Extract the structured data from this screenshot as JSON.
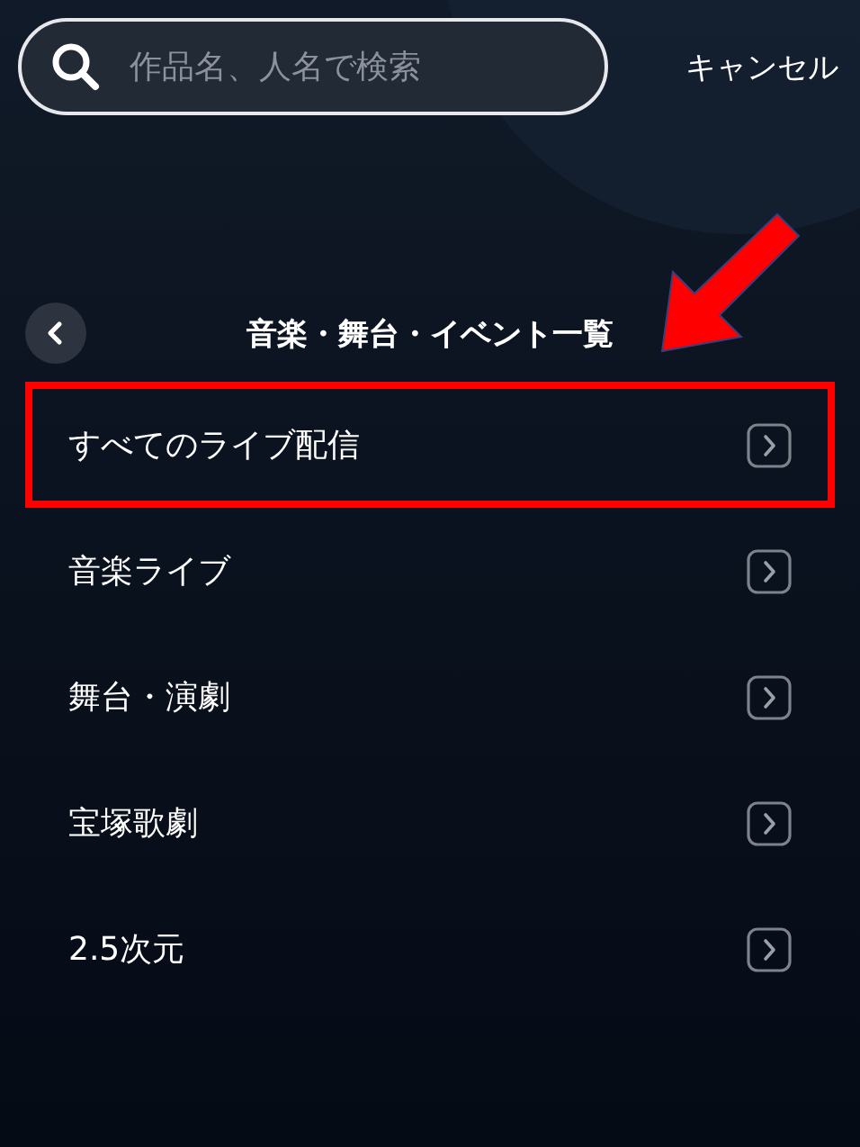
{
  "search": {
    "placeholder": "作品名、人名で検索"
  },
  "cancel_button": "キャンセル",
  "header": {
    "title": "音楽・舞台・イベント一覧"
  },
  "annotation": {
    "arrow": true
  },
  "items": [
    {
      "label": "すべてのライブ配信",
      "highlighted": true
    },
    {
      "label": "音楽ライブ",
      "highlighted": false
    },
    {
      "label": "舞台・演劇",
      "highlighted": false
    },
    {
      "label": "宝塚歌劇",
      "highlighted": false
    },
    {
      "label": "2.5次元",
      "highlighted": false
    }
  ]
}
